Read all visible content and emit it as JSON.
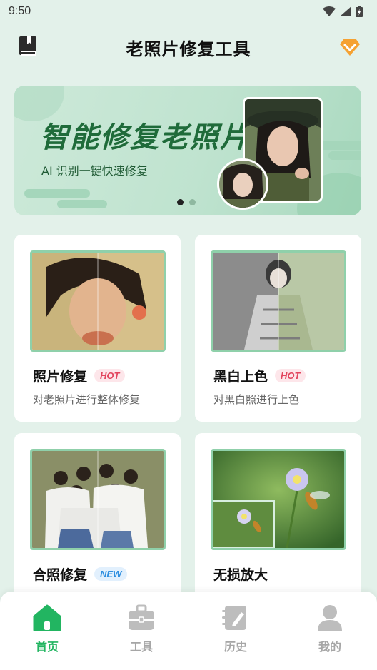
{
  "status_bar": {
    "time": "9:50"
  },
  "header": {
    "title": "老照片修复工具"
  },
  "banner": {
    "title": "智能修复老照片",
    "subtitle": "AI 识别一键快速修复"
  },
  "cards": [
    {
      "title": "照片修复",
      "badge": "HOT",
      "desc": "对老照片进行整体修复"
    },
    {
      "title": "黑白上色",
      "badge": "HOT",
      "desc": "对黑白照进行上色"
    },
    {
      "title": "合照修复",
      "badge": "NEW",
      "desc": ""
    },
    {
      "title": "无损放大",
      "badge": "",
      "desc": ""
    }
  ],
  "tabs": [
    {
      "label": "首页",
      "icon": "home-icon",
      "active": true
    },
    {
      "label": "工具",
      "icon": "toolbox-icon"
    },
    {
      "label": "历史",
      "icon": "history-icon"
    },
    {
      "label": "我的",
      "icon": "profile-icon"
    }
  ],
  "colors": {
    "accent": "#22b561",
    "banner_text": "#1f6b3a",
    "hot": "#e2455e",
    "new": "#2e8fe0",
    "vip": "#f5a233"
  }
}
